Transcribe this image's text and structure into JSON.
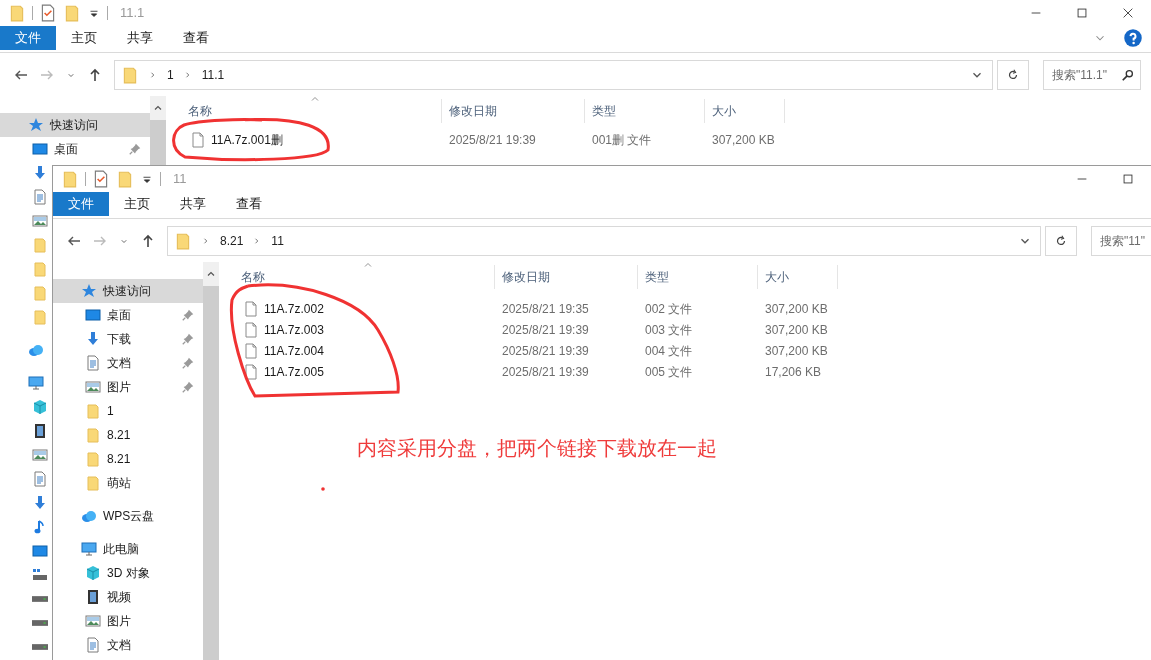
{
  "windows": [
    {
      "title": "11.1",
      "controls": [
        {
          "kind": "minimize"
        },
        {
          "kind": "maximize"
        },
        {
          "kind": "close"
        }
      ],
      "ribbon_tabs": [
        {
          "label": "文件",
          "selected": true
        },
        {
          "label": "主页",
          "selected": false
        },
        {
          "label": "共享",
          "selected": false
        },
        {
          "label": "查看",
          "selected": false
        }
      ],
      "ribbon_help": true,
      "address": [
        "1",
        "11.1"
      ],
      "search": {
        "placeholder": "搜索\"11.1\"",
        "icon": true
      },
      "sidebar": [
        {
          "kind": "quick",
          "label": "快速访问",
          "selected": true,
          "children": [
            {
              "kind": "desktop",
              "label": "桌面",
              "pinned": true,
              "selected": false
            },
            {
              "kind": "download",
              "selected": false
            },
            {
              "kind": "document",
              "selected": false
            },
            {
              "kind": "picture",
              "selected": false
            },
            {
              "kind": "folder",
              "selected": false
            },
            {
              "kind": "folder",
              "selected": false
            },
            {
              "kind": "folder",
              "selected": false
            },
            {
              "kind": "folder",
              "selected": false
            }
          ]
        },
        {
          "kind": "cloud",
          "selected": false
        },
        {
          "kind": "pc",
          "selected": false,
          "children": [
            {
              "kind": "cube3d",
              "selected": false
            },
            {
              "kind": "video",
              "selected": false
            },
            {
              "kind": "picture",
              "selected": false
            },
            {
              "kind": "document",
              "selected": false
            },
            {
              "kind": "download",
              "selected": false
            },
            {
              "kind": "music",
              "selected": false
            },
            {
              "kind": "desktop",
              "selected": false
            },
            {
              "kind": "netdrive",
              "selected": false
            },
            {
              "kind": "drive",
              "selected": false
            },
            {
              "kind": "drive",
              "selected": false
            },
            {
              "kind": "drive",
              "selected": false
            }
          ]
        }
      ],
      "columns": [
        "名称",
        "修改日期",
        "类型",
        "大小"
      ],
      "files": [
        {
          "name": "11A.7z.001删",
          "modified": "2025/8/21 19:39",
          "type": "001删 文件",
          "size": "307,200 KB"
        }
      ]
    },
    {
      "title": "11",
      "controls": [
        {
          "kind": "minimize"
        },
        {
          "kind": "maximize"
        }
      ],
      "ribbon_tabs": [
        {
          "label": "文件",
          "selected": true
        },
        {
          "label": "主页",
          "selected": false
        },
        {
          "label": "共享",
          "selected": false
        },
        {
          "label": "查看",
          "selected": false
        }
      ],
      "address": [
        "8.21",
        "11"
      ],
      "search": {
        "placeholder": "搜索\"11\"",
        "icon": false
      },
      "sidebar": [
        {
          "kind": "quick",
          "label": "快速访问",
          "selected": true,
          "children": [
            {
              "kind": "desktop",
              "label": "桌面",
              "pinned": true,
              "selected": false
            },
            {
              "kind": "download",
              "label": "下载",
              "pinned": true,
              "selected": false
            },
            {
              "kind": "document",
              "label": "文档",
              "pinned": true,
              "selected": false
            },
            {
              "kind": "picture",
              "label": "图片",
              "pinned": true,
              "selected": false
            },
            {
              "kind": "folder",
              "label": "1",
              "pinned": false,
              "selected": false
            },
            {
              "kind": "folder",
              "label": "8.21",
              "pinned": false,
              "selected": false
            },
            {
              "kind": "folder",
              "label": "8.21",
              "pinned": false,
              "selected": false
            },
            {
              "kind": "folder",
              "label": "萌站",
              "pinned": false,
              "selected": false
            }
          ]
        },
        {
          "kind": "cloud",
          "label": "WPS云盘",
          "selected": false
        },
        {
          "kind": "pc",
          "label": "此电脑",
          "selected": false,
          "children": [
            {
              "kind": "cube3d",
              "label": "3D 对象",
              "selected": false
            },
            {
              "kind": "video",
              "label": "视频",
              "selected": false
            },
            {
              "kind": "picture",
              "label": "图片",
              "selected": false
            },
            {
              "kind": "document",
              "label": "文档",
              "selected": false
            }
          ]
        }
      ],
      "columns": [
        "名称",
        "修改日期",
        "类型",
        "大小"
      ],
      "files": [
        {
          "name": "11A.7z.002",
          "modified": "2025/8/21 19:35",
          "type": "002 文件",
          "size": "307,200 KB"
        },
        {
          "name": "11A.7z.003",
          "modified": "2025/8/21 19:39",
          "type": "003 文件",
          "size": "307,200 KB"
        },
        {
          "name": "11A.7z.004",
          "modified": "2025/8/21 19:39",
          "type": "004 文件",
          "size": "307,200 KB"
        },
        {
          "name": "11A.7z.005",
          "modified": "2025/8/21 19:39",
          "type": "005 文件",
          "size": "17,206 KB"
        }
      ]
    }
  ],
  "annotation": {
    "note": "内容采用分盘，把两个链接下载放在一起"
  }
}
